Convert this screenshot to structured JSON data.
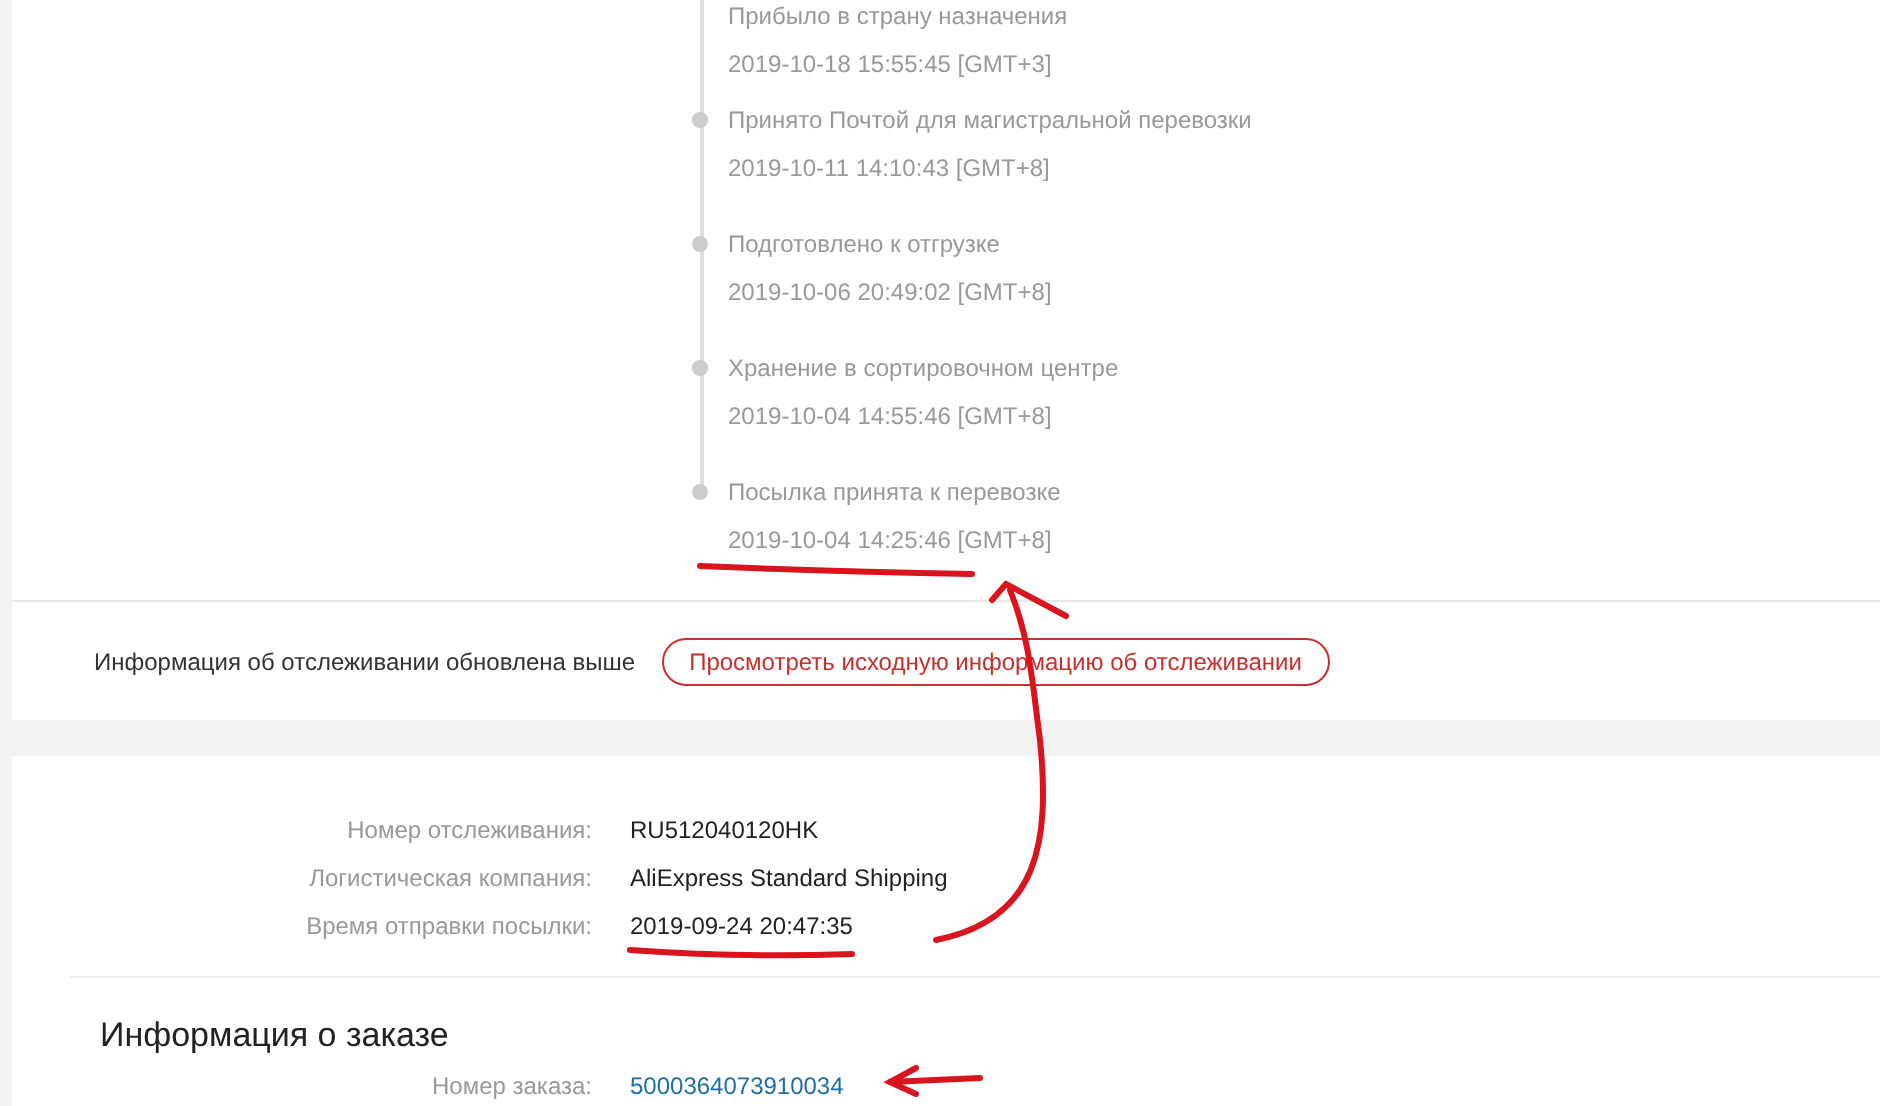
{
  "timeline": [
    {
      "title": "Прибыло в страну назначения",
      "time": "2019-10-18 15:55:45 [GMT+3]"
    },
    {
      "title": "Принято Почтой для магистральной перевозки",
      "time": "2019-10-11 14:10:43 [GMT+8]"
    },
    {
      "title": "Подготовлено к отгрузке",
      "time": "2019-10-06 20:49:02 [GMT+8]"
    },
    {
      "title": "Хранение в сортировочном центре",
      "time": "2019-10-04 14:55:46 [GMT+8]"
    },
    {
      "title": "Посылка принята к перевозке",
      "time": "2019-10-04 14:25:46 [GMT+8]"
    }
  ],
  "update_note": "Информация об отслеживании обновлена выше",
  "original_info_button": "Просмотреть исходную информацию об отслеживании",
  "shipment": [
    {
      "label": "Номер отслеживания:",
      "value": "RU512040120HK"
    },
    {
      "label": "Логистическая компания:",
      "value": "AliExpress Standard Shipping"
    },
    {
      "label": "Время отправки посылки:",
      "value": "2019-09-24 20:47:35"
    }
  ],
  "order": {
    "heading": "Информация о заказе",
    "label": "Номер заказа:",
    "number": "5000364073910034"
  }
}
